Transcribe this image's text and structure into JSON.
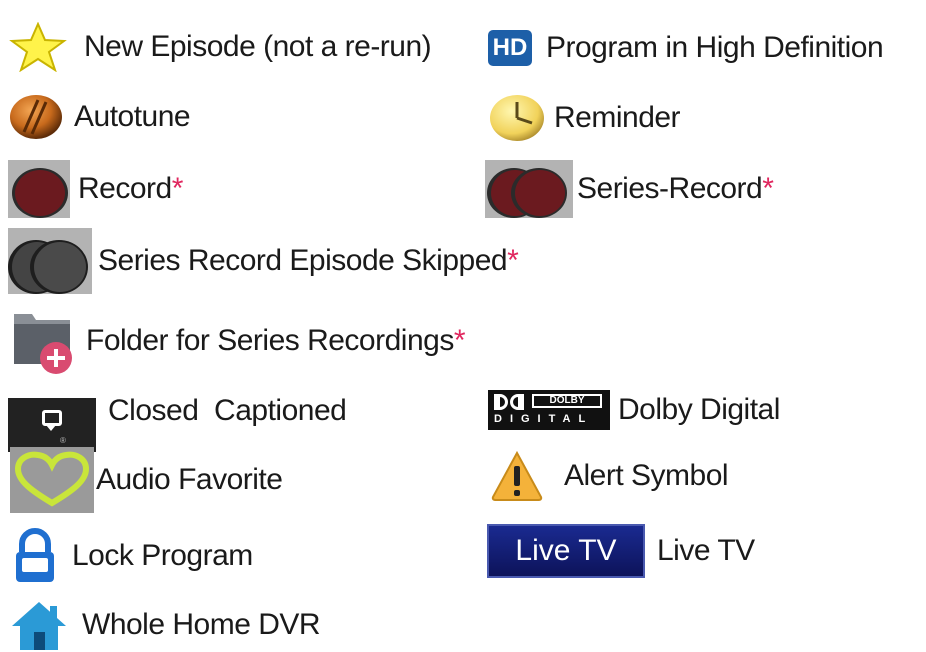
{
  "legend": {
    "new_episode": "New Episode (not a re-run)",
    "hd": "Program in High Definition",
    "hd_badge": "HD",
    "autotune": "Autotune",
    "reminder": "Reminder",
    "record": "Record",
    "series_record": "Series-Record",
    "series_skipped": "Series Record Episode Skipped",
    "folder": "Folder for Series Recordings",
    "closed_captioned": "Closed  Captioned",
    "dolby_digital": "Dolby Digital",
    "dolby_badge_top": "DOLBY",
    "dolby_badge_bottom": "DIGITAL",
    "audio_favorite": "Audio Favorite",
    "alert": "Alert Symbol",
    "lock": "Lock Program",
    "live_tv": "Live TV",
    "live_tv_badge": "Live TV",
    "whole_home_dvr": "Whole Home DVR",
    "asterisk": "*"
  },
  "colors": {
    "text": "#1a1a1a",
    "asterisk": "#e0265e",
    "record_red": "#6b1a1f",
    "hd_blue": "#1d5fa8",
    "live_tv_bg": "#101a6e"
  }
}
